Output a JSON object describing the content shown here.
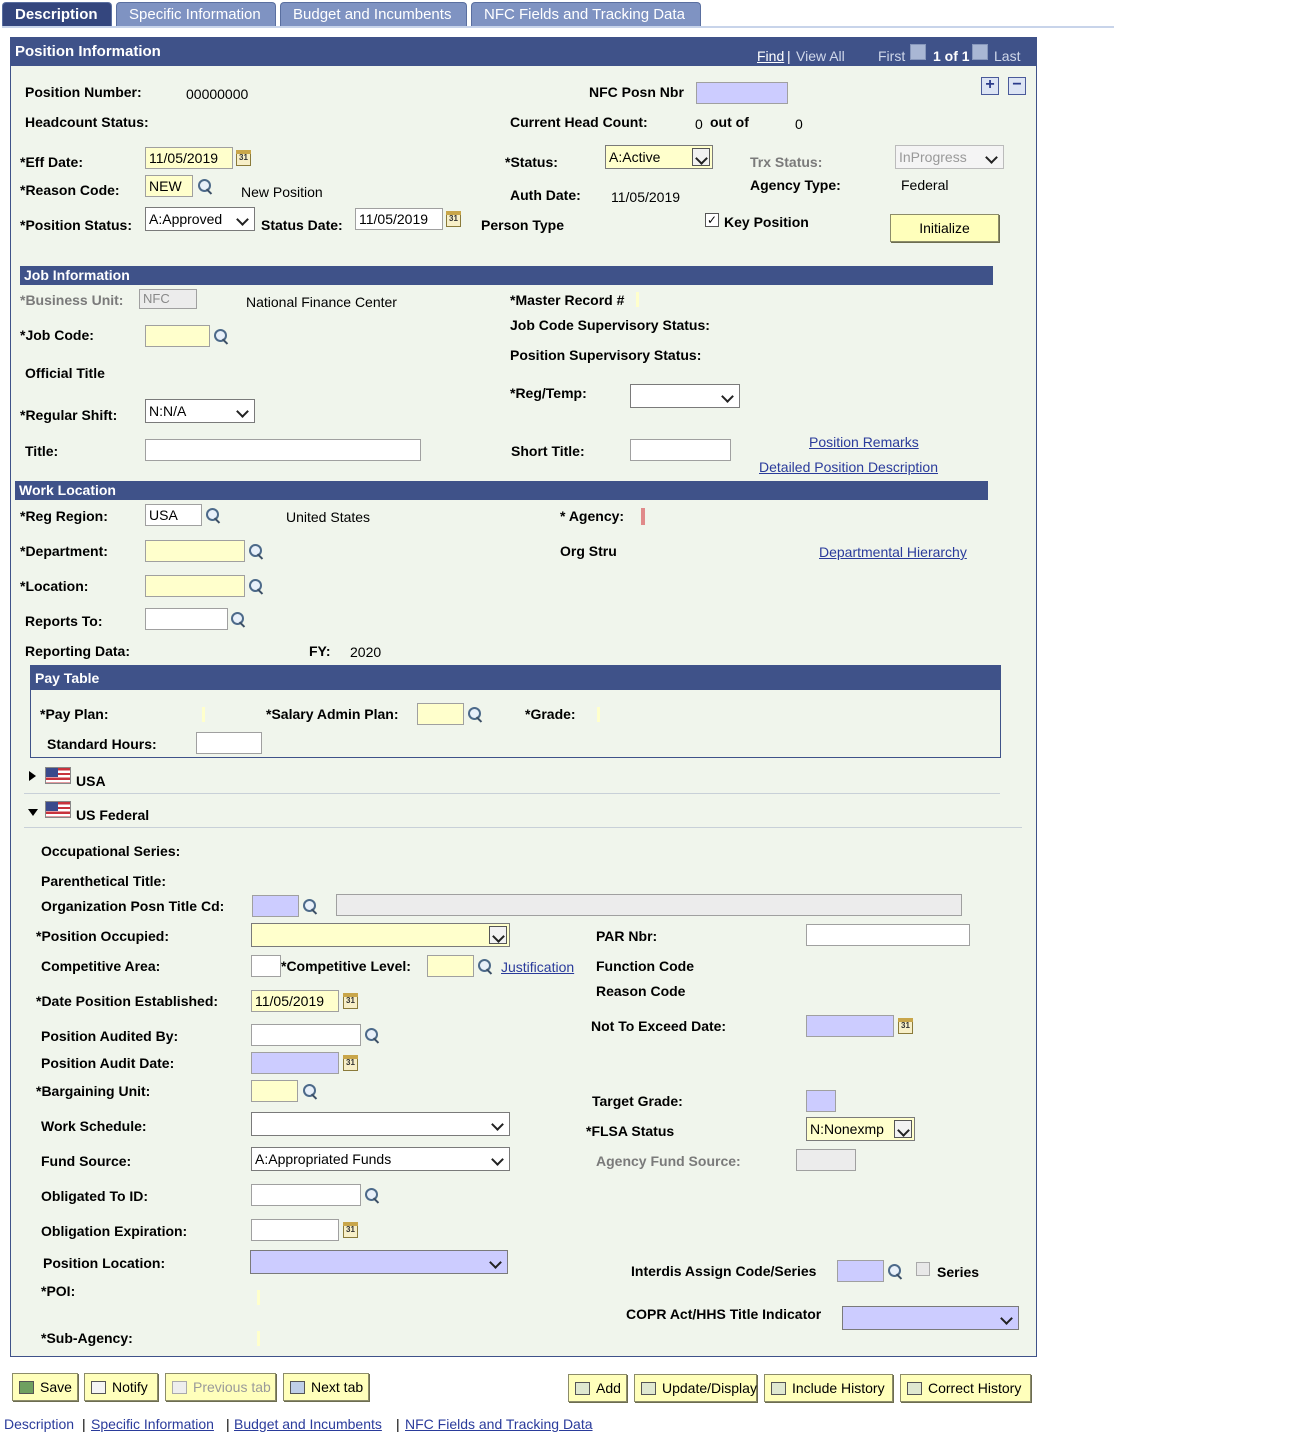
{
  "tabs": [
    {
      "label": "Description"
    },
    {
      "label": "Specific Information"
    },
    {
      "label": "Budget and Incumbents"
    },
    {
      "label": "NFC Fields and Tracking Data"
    }
  ],
  "position_info": {
    "header": "Position Information",
    "nav": {
      "find": "Find",
      "view_all": "View All",
      "first": "First",
      "count": "1 of 1",
      "last": "Last"
    },
    "position_number_label": "Position Number:",
    "position_number": "00000000",
    "nfc_posn_nbr_label": "NFC Posn Nbr",
    "headcount_status_label": "Headcount Status:",
    "current_head_count_label": "Current Head Count:",
    "current_head_count": "0",
    "out_of_label": "out of",
    "out_of": "0",
    "eff_date_label": "*Eff Date:",
    "eff_date": "11/05/2019",
    "status_label": "*Status:",
    "status": "A:Active",
    "trx_status_label": "Trx Status:",
    "trx_status": "InProgress",
    "reason_code_label": "*Reason Code:",
    "reason_code": "NEW",
    "reason_desc": "New Position",
    "auth_date_label": "Auth Date:",
    "auth_date": "11/05/2019",
    "agency_type_label": "Agency Type:",
    "agency_type": "Federal",
    "position_status_label": "*Position Status:",
    "position_status": "A:Approved",
    "status_date_label": "Status Date:",
    "status_date": "11/05/2019",
    "person_type_label": "Person Type",
    "key_position_label": "Key Position",
    "key_position_checked": "✓",
    "initialize_button": "Initialize"
  },
  "job_info": {
    "header": "Job Information",
    "business_unit_label": "*Business Unit:",
    "business_unit": "NFC",
    "business_unit_desc": "National Finance Center",
    "master_record_label": "*Master Record #",
    "job_code_label": "*Job Code:",
    "job_code_sup_label": "Job Code Supervisory Status:",
    "position_sup_label": "Position Supervisory Status:",
    "official_title_label": "Official Title",
    "reg_temp_label": "*Reg/Temp:",
    "regular_shift_label": "*Regular Shift:",
    "regular_shift": "N:N/A",
    "title_label": "Title:",
    "short_title_label": "Short Title:",
    "position_remarks_link": "Position Remarks",
    "detailed_desc_link": "Detailed Position Description"
  },
  "work_location": {
    "header": "Work Location",
    "reg_region_label": "*Reg Region:",
    "reg_region": "USA",
    "reg_region_desc": "United States",
    "agency_label": "* Agency:",
    "department_label": "*Department:",
    "org_stru_label": "Org Stru",
    "dept_hierarchy_link": "Departmental Hierarchy",
    "location_label": "*Location:",
    "reports_to_label": "Reports To:",
    "reporting_data_label": "Reporting Data:",
    "fy_label": "FY:",
    "fy": "2020"
  },
  "pay_table": {
    "header": "Pay Table",
    "pay_plan_label": "*Pay Plan:",
    "salary_admin_plan_label": "*Salary Admin Plan:",
    "grade_label": "*Grade:",
    "standard_hours_label": "Standard Hours:"
  },
  "country_sections": {
    "usa": "USA",
    "us_federal": "US Federal"
  },
  "us_federal": {
    "occupational_series_label": "Occupational Series:",
    "parenthetical_title_label": "Parenthetical Title:",
    "org_posn_title_label": "Organization Posn Title Cd:",
    "position_occupied_label": "*Position Occupied:",
    "par_nbr_label": "PAR Nbr:",
    "competitive_area_label": "Competitive Area:",
    "competitive_level_label": "*Competitive Level:",
    "justification_link": "Justification",
    "function_code_label": "Function Code",
    "reason_code_label": "Reason Code",
    "date_established_label": "*Date Position Established:",
    "date_established": "11/05/2019",
    "not_to_exceed_label": "Not To Exceed Date:",
    "audited_by_label": "Position Audited By:",
    "audit_date_label": "Position Audit Date:",
    "bargaining_unit_label": "*Bargaining Unit:",
    "target_grade_label": "Target Grade:",
    "work_schedule_label": "Work Schedule:",
    "flsa_status_label": "*FLSA Status",
    "flsa_status": "N:Nonexmp",
    "fund_source_label": "Fund Source:",
    "fund_source": "A:Appropriated Funds",
    "agency_fund_source_label": "Agency Fund Source:",
    "obligated_to_label": "Obligated To ID:",
    "obligation_exp_label": "Obligation Expiration:",
    "position_location_label": "Position Location:",
    "interdis_label": "Interdis Assign Code/Series",
    "series_label": "Series",
    "poi_label": "*POI:",
    "copr_label": "COPR Act/HHS Title Indicator",
    "sub_agency_label": "*Sub-Agency:"
  },
  "toolbar": {
    "save": "Save",
    "notify": "Notify",
    "previous_tab": "Previous tab",
    "next_tab": "Next tab",
    "add": "Add",
    "update_display": "Update/Display",
    "include_history": "Include History",
    "correct_history": "Correct History"
  },
  "footer_links": {
    "description": "Description",
    "specific_info": "Specific Information",
    "budget": "Budget and Incumbents",
    "nfc_fields": "NFC Fields and Tracking Data",
    "sep": "|"
  },
  "colors": {
    "header_bar": "#3f5289",
    "panel_bg": "#f0f5ec",
    "required_field": "#ffffcc",
    "lavender_field": "#ccccff"
  }
}
